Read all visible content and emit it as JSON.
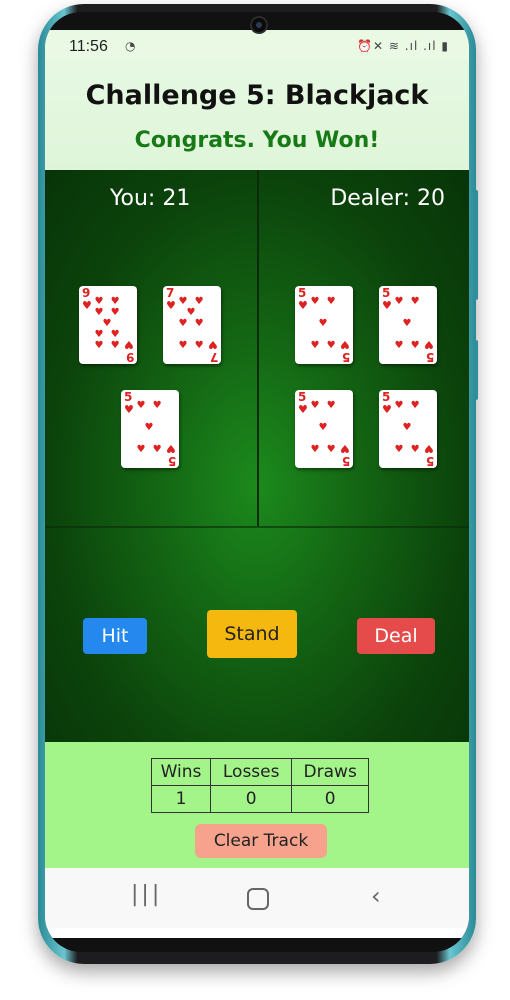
{
  "status_bar": {
    "time": "11:56",
    "left_icon": "sync-icon",
    "right_icons": "⏰✕ ≋ .ıl .ıl ▮"
  },
  "header": {
    "title": "Challenge 5: Blackjack",
    "result": "Congrats. You Won!"
  },
  "player": {
    "score_label": "You: 21",
    "cards": [
      {
        "rank": "9",
        "suit": "♥"
      },
      {
        "rank": "7",
        "suit": "♥"
      },
      {
        "rank": "5",
        "suit": "♥"
      }
    ]
  },
  "dealer": {
    "score_label": "Dealer: 20",
    "cards": [
      {
        "rank": "5",
        "suit": "♥"
      },
      {
        "rank": "5",
        "suit": "♥"
      },
      {
        "rank": "5",
        "suit": "♥"
      },
      {
        "rank": "5",
        "suit": "♥"
      }
    ]
  },
  "controls": {
    "hit": "Hit",
    "stand": "Stand",
    "deal": "Deal"
  },
  "stats": {
    "headers": [
      "Wins",
      "Losses",
      "Draws"
    ],
    "values": [
      "1",
      "0",
      "0"
    ]
  },
  "clear_button": "Clear Track",
  "colors": {
    "table_green": "#136413",
    "hit": "#2488ee",
    "stand": "#f5b80f",
    "deal": "#e64b4b",
    "footer": "#a3f58a",
    "result_text": "#177a17"
  }
}
